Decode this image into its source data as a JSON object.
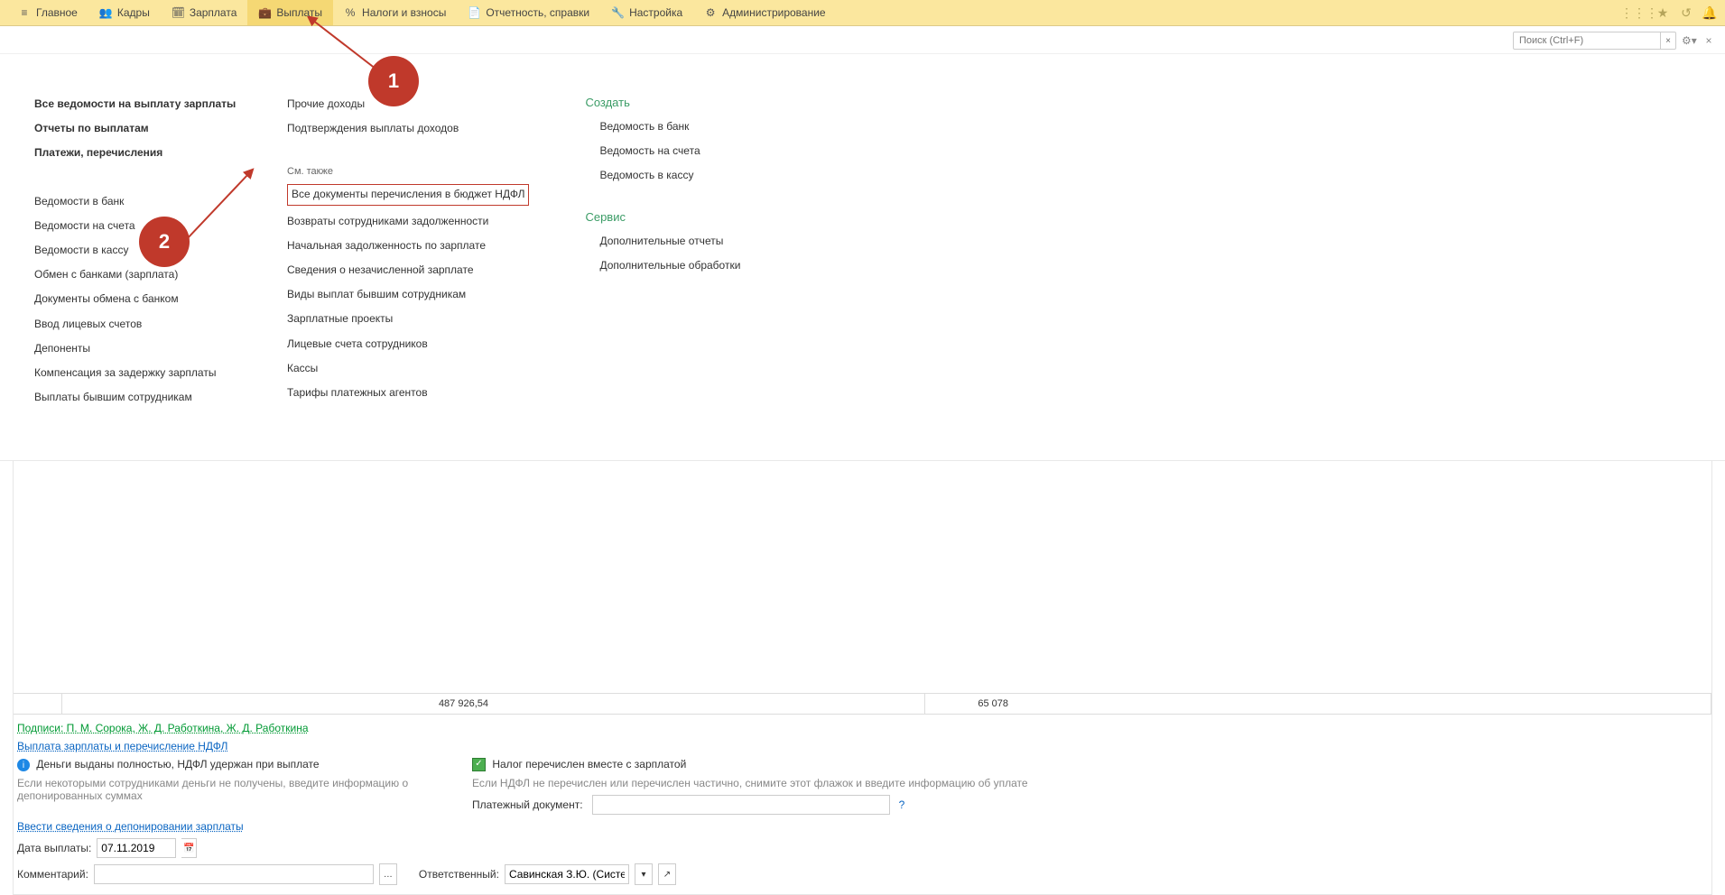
{
  "menu": {
    "items": [
      {
        "icon": "≡",
        "label": "Главное"
      },
      {
        "icon": "👥",
        "label": "Кадры"
      },
      {
        "icon": "🗓",
        "label": "Зарплата"
      },
      {
        "icon": "💼",
        "label": "Выплаты"
      },
      {
        "icon": "%",
        "label": "Налоги и взносы"
      },
      {
        "icon": "📄",
        "label": "Отчетность, справки"
      },
      {
        "icon": "🔧",
        "label": "Настройка"
      },
      {
        "icon": "⚙",
        "label": "Администрирование"
      }
    ]
  },
  "search": {
    "placeholder": "Поиск (Ctrl+F)"
  },
  "nav": {
    "col1": {
      "bold": [
        "Все ведомости на выплату зарплаты",
        "Отчеты по выплатам",
        "Платежи, перечисления"
      ],
      "items": [
        "Ведомости в банк",
        "Ведомости на счета",
        "Ведомости в кассу",
        "Обмен с банками (зарплата)",
        "Документы обмена с банком",
        "Ввод лицевых счетов",
        "Депоненты",
        "Компенсация за задержку зарплаты",
        "Выплаты бывшим сотрудникам"
      ]
    },
    "col2": {
      "top": [
        "Прочие доходы",
        "Подтверждения выплаты доходов"
      ],
      "see_also_label": "См. также",
      "highlighted": "Все документы перечисления в бюджет НДФЛ",
      "items": [
        "Возвраты сотрудниками задолженности",
        "Начальная задолженность по зарплате",
        "Сведения о незачисленной зарплате",
        "Виды выплат бывшим сотрудникам",
        "Зарплатные проекты",
        "Лицевые счета сотрудников",
        "Кассы",
        "Тарифы платежных агентов"
      ]
    },
    "col3": {
      "create_heading": "Создать",
      "create_items": [
        "Ведомость в банк",
        "Ведомость на счета",
        "Ведомость в кассу"
      ],
      "service_heading": "Сервис",
      "service_items": [
        "Дополнительные отчеты",
        "Дополнительные обработки"
      ]
    }
  },
  "annotations": {
    "circle1": "1",
    "circle2": "2"
  },
  "summary": {
    "amount1": "487 926,54",
    "amount2": "65 078"
  },
  "form": {
    "signatures": "Подписи: П. М. Сорока, Ж. Д. Работкина, Ж. Д. Работкина",
    "section_link": "Выплата зарплаты и перечисление НДФЛ",
    "money_status": "Деньги выданы полностью, НДФЛ удержан при выплате",
    "money_hint": "Если некоторыми сотрудниками деньги не получены, введите информацию о депонированных суммах",
    "tax_checkbox_label": "Налог перечислен вместе с зарплатой",
    "tax_hint": "Если НДФЛ не перечислен или перечислен частично, снимите этот флажок и введите информацию об уплате",
    "deposit_link": "Ввести сведения о депонировании зарплаты",
    "payment_doc_label": "Платежный документ:",
    "pay_date_label": "Дата выплаты:",
    "pay_date_value": "07.11.2019",
    "comment_label": "Комментарий:",
    "responsible_label": "Ответственный:",
    "responsible_value": "Савинская З.Ю. (Системн"
  }
}
